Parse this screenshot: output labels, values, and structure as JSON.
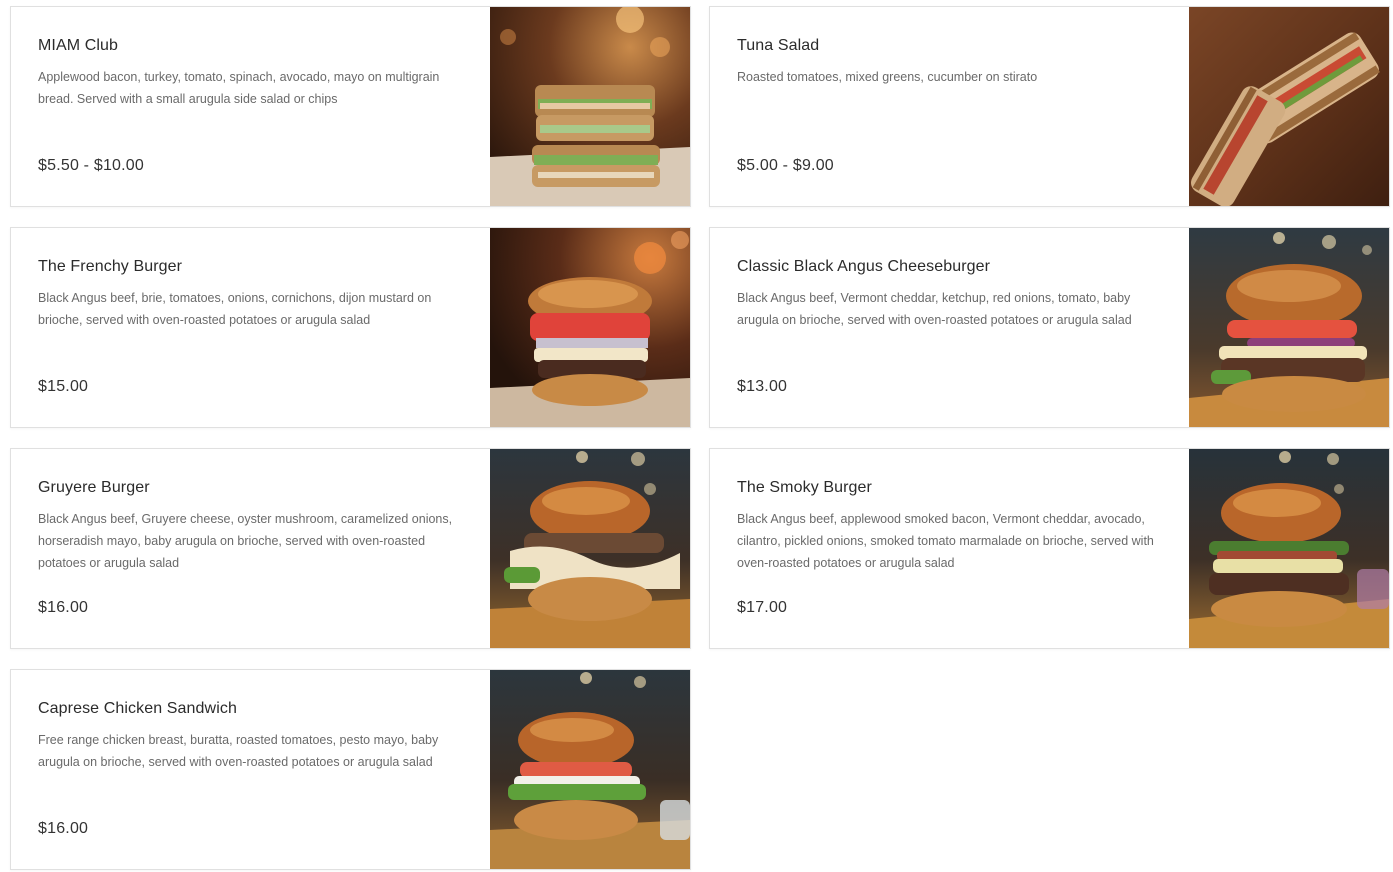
{
  "menu": {
    "items": [
      {
        "title": "MIAM Club",
        "description": "Applewood bacon, turkey, tomato, spinach, avocado, mayo on multigrain bread. Served with a small arugula side salad or chips",
        "price": "$5.50 - $10.00",
        "photo": "club-sandwich-photo"
      },
      {
        "title": "Tuna Salad",
        "description": "Roasted tomatoes, mixed greens, cucumber on stirato",
        "price": "$5.00 - $9.00",
        "photo": "panini-photo"
      },
      {
        "title": "The Frenchy Burger",
        "description": "Black Angus beef, brie, tomatoes, onions, cornichons, dijon mustard on brioche, served with oven-roasted potatoes or arugula salad",
        "price": "$15.00",
        "photo": "burger-photo"
      },
      {
        "title": "Classic Black Angus Cheeseburger",
        "description": "Black Angus beef, Vermont cheddar, ketchup, red onions, tomato, baby arugula on brioche, served with oven-roasted potatoes or arugula salad",
        "price": "$13.00",
        "photo": "burger-photo"
      },
      {
        "title": "Gruyere Burger",
        "description": "Black Angus beef, Gruyere cheese, oyster mushroom, caramelized onions, horseradish mayo, baby arugula on brioche, served with oven-roasted potatoes or arugula salad",
        "price": "$16.00",
        "photo": "burger-photo"
      },
      {
        "title": "The Smoky Burger",
        "description": "Black Angus beef, applewood smoked bacon, Vermont cheddar, avocado, cilantro, pickled onions, smoked tomato marmalade on brioche, served with oven-roasted potatoes or arugula salad",
        "price": "$17.00",
        "photo": "burger-photo"
      },
      {
        "title": "Caprese Chicken Sandwich",
        "description": "Free range chicken breast, buratta, roasted tomatoes, pesto mayo, baby arugula on brioche, served with oven-roasted potatoes or arugula salad",
        "price": "$16.00",
        "photo": "chicken-sandwich-photo"
      }
    ]
  },
  "colors": {
    "card_border": "#e0e0e0",
    "title_text": "#2b2b2b",
    "description_text": "#6a6a6a",
    "price_text": "#333333"
  }
}
